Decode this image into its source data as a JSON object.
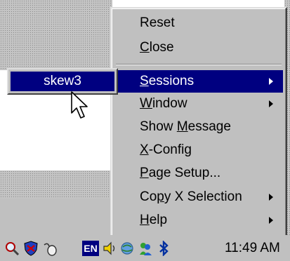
{
  "menu": {
    "items": [
      {
        "label": "Reset",
        "mnemonic": "",
        "submenu": false,
        "selected": false
      },
      {
        "label": "Close",
        "mnemonic": "C",
        "submenu": false,
        "selected": false
      },
      {
        "label": "Sessions",
        "mnemonic": "S",
        "submenu": true,
        "selected": true
      },
      {
        "label": "Window",
        "mnemonic": "W",
        "submenu": true,
        "selected": false
      },
      {
        "label": "Show Message",
        "mnemonic": "M",
        "submenu": false,
        "selected": false
      },
      {
        "label": "X-Config",
        "mnemonic": "X",
        "submenu": false,
        "selected": false
      },
      {
        "label": "Page Setup...",
        "mnemonic": "P",
        "submenu": false,
        "selected": false
      },
      {
        "label": "Copy X Selection",
        "mnemonic": "p",
        "submenu": true,
        "selected": false
      },
      {
        "label": "Help",
        "mnemonic": "H",
        "submenu": true,
        "selected": false
      }
    ]
  },
  "submenu": {
    "items": [
      {
        "label": "skew3",
        "selected": true
      }
    ]
  },
  "taskbar": {
    "language": "EN",
    "clock": "11:49 AM",
    "tray_icons": [
      "magnifier-icon",
      "shield-icon",
      "mouse-icon",
      "language-icon",
      "speaker-icon",
      "network-icon",
      "messenger-icon",
      "bluetooth-icon"
    ]
  },
  "colors": {
    "highlight": "#000080",
    "menu_bg": "#c0c0c0",
    "highlight_text": "#ffffff"
  }
}
